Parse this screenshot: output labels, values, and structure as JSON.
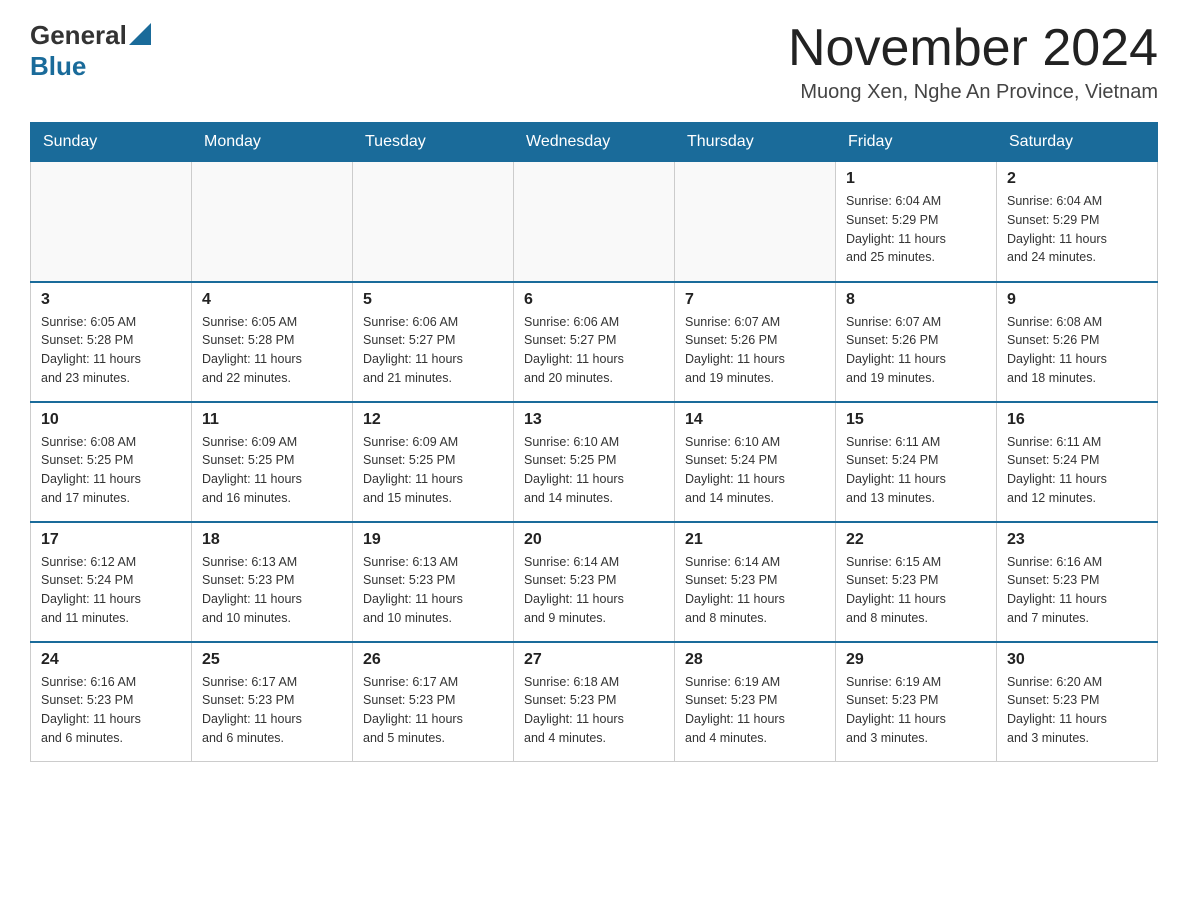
{
  "header": {
    "logo": {
      "general": "General",
      "blue": "Blue"
    },
    "title": "November 2024",
    "subtitle": "Muong Xen, Nghe An Province, Vietnam"
  },
  "calendar": {
    "days_of_week": [
      "Sunday",
      "Monday",
      "Tuesday",
      "Wednesday",
      "Thursday",
      "Friday",
      "Saturday"
    ],
    "weeks": [
      {
        "days": [
          {
            "number": "",
            "info": ""
          },
          {
            "number": "",
            "info": ""
          },
          {
            "number": "",
            "info": ""
          },
          {
            "number": "",
            "info": ""
          },
          {
            "number": "",
            "info": ""
          },
          {
            "number": "1",
            "info": "Sunrise: 6:04 AM\nSunset: 5:29 PM\nDaylight: 11 hours\nand 25 minutes."
          },
          {
            "number": "2",
            "info": "Sunrise: 6:04 AM\nSunset: 5:29 PM\nDaylight: 11 hours\nand 24 minutes."
          }
        ]
      },
      {
        "days": [
          {
            "number": "3",
            "info": "Sunrise: 6:05 AM\nSunset: 5:28 PM\nDaylight: 11 hours\nand 23 minutes."
          },
          {
            "number": "4",
            "info": "Sunrise: 6:05 AM\nSunset: 5:28 PM\nDaylight: 11 hours\nand 22 minutes."
          },
          {
            "number": "5",
            "info": "Sunrise: 6:06 AM\nSunset: 5:27 PM\nDaylight: 11 hours\nand 21 minutes."
          },
          {
            "number": "6",
            "info": "Sunrise: 6:06 AM\nSunset: 5:27 PM\nDaylight: 11 hours\nand 20 minutes."
          },
          {
            "number": "7",
            "info": "Sunrise: 6:07 AM\nSunset: 5:26 PM\nDaylight: 11 hours\nand 19 minutes."
          },
          {
            "number": "8",
            "info": "Sunrise: 6:07 AM\nSunset: 5:26 PM\nDaylight: 11 hours\nand 19 minutes."
          },
          {
            "number": "9",
            "info": "Sunrise: 6:08 AM\nSunset: 5:26 PM\nDaylight: 11 hours\nand 18 minutes."
          }
        ]
      },
      {
        "days": [
          {
            "number": "10",
            "info": "Sunrise: 6:08 AM\nSunset: 5:25 PM\nDaylight: 11 hours\nand 17 minutes."
          },
          {
            "number": "11",
            "info": "Sunrise: 6:09 AM\nSunset: 5:25 PM\nDaylight: 11 hours\nand 16 minutes."
          },
          {
            "number": "12",
            "info": "Sunrise: 6:09 AM\nSunset: 5:25 PM\nDaylight: 11 hours\nand 15 minutes."
          },
          {
            "number": "13",
            "info": "Sunrise: 6:10 AM\nSunset: 5:25 PM\nDaylight: 11 hours\nand 14 minutes."
          },
          {
            "number": "14",
            "info": "Sunrise: 6:10 AM\nSunset: 5:24 PM\nDaylight: 11 hours\nand 14 minutes."
          },
          {
            "number": "15",
            "info": "Sunrise: 6:11 AM\nSunset: 5:24 PM\nDaylight: 11 hours\nand 13 minutes."
          },
          {
            "number": "16",
            "info": "Sunrise: 6:11 AM\nSunset: 5:24 PM\nDaylight: 11 hours\nand 12 minutes."
          }
        ]
      },
      {
        "days": [
          {
            "number": "17",
            "info": "Sunrise: 6:12 AM\nSunset: 5:24 PM\nDaylight: 11 hours\nand 11 minutes."
          },
          {
            "number": "18",
            "info": "Sunrise: 6:13 AM\nSunset: 5:23 PM\nDaylight: 11 hours\nand 10 minutes."
          },
          {
            "number": "19",
            "info": "Sunrise: 6:13 AM\nSunset: 5:23 PM\nDaylight: 11 hours\nand 10 minutes."
          },
          {
            "number": "20",
            "info": "Sunrise: 6:14 AM\nSunset: 5:23 PM\nDaylight: 11 hours\nand 9 minutes."
          },
          {
            "number": "21",
            "info": "Sunrise: 6:14 AM\nSunset: 5:23 PM\nDaylight: 11 hours\nand 8 minutes."
          },
          {
            "number": "22",
            "info": "Sunrise: 6:15 AM\nSunset: 5:23 PM\nDaylight: 11 hours\nand 8 minutes."
          },
          {
            "number": "23",
            "info": "Sunrise: 6:16 AM\nSunset: 5:23 PM\nDaylight: 11 hours\nand 7 minutes."
          }
        ]
      },
      {
        "days": [
          {
            "number": "24",
            "info": "Sunrise: 6:16 AM\nSunset: 5:23 PM\nDaylight: 11 hours\nand 6 minutes."
          },
          {
            "number": "25",
            "info": "Sunrise: 6:17 AM\nSunset: 5:23 PM\nDaylight: 11 hours\nand 6 minutes."
          },
          {
            "number": "26",
            "info": "Sunrise: 6:17 AM\nSunset: 5:23 PM\nDaylight: 11 hours\nand 5 minutes."
          },
          {
            "number": "27",
            "info": "Sunrise: 6:18 AM\nSunset: 5:23 PM\nDaylight: 11 hours\nand 4 minutes."
          },
          {
            "number": "28",
            "info": "Sunrise: 6:19 AM\nSunset: 5:23 PM\nDaylight: 11 hours\nand 4 minutes."
          },
          {
            "number": "29",
            "info": "Sunrise: 6:19 AM\nSunset: 5:23 PM\nDaylight: 11 hours\nand 3 minutes."
          },
          {
            "number": "30",
            "info": "Sunrise: 6:20 AM\nSunset: 5:23 PM\nDaylight: 11 hours\nand 3 minutes."
          }
        ]
      }
    ]
  }
}
